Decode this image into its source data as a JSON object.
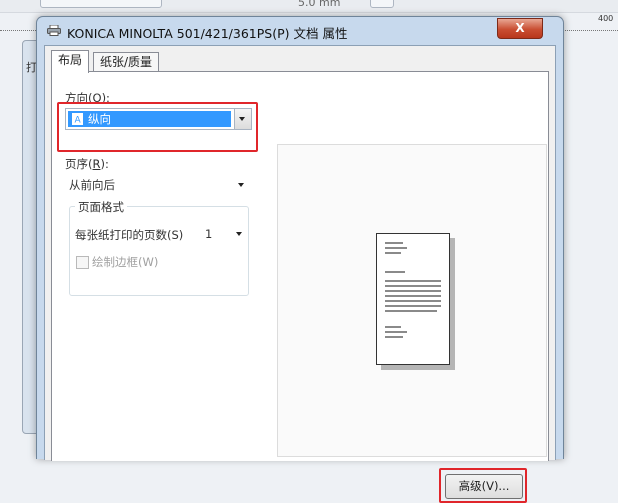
{
  "background": {
    "title_fragment": "5.0 mm",
    "ruler_number": "400",
    "panel_label": "打"
  },
  "dialog": {
    "title": "KONICA MINOLTA 501/421/361PS(P) 文档 属性",
    "close_label": "X",
    "tabs": [
      {
        "label": "布局",
        "active": true
      },
      {
        "label": "纸张/质量",
        "active": false
      }
    ],
    "orientation": {
      "label": "方向(O):",
      "label_text": "方向(",
      "label_key": "O",
      "label_end": "):",
      "value": "纵向"
    },
    "page_order": {
      "label_text": "页序(",
      "label_key": "R",
      "label_end": "):",
      "value": "从前向后"
    },
    "page_format": {
      "group_label": "页面格式",
      "pages_per_sheet_label": "每张纸打印的页数(S)",
      "pages_per_sheet_value": "1",
      "draw_borders_label": "绘制边框(W)",
      "draw_borders_checked": false
    },
    "advanced_button": "高级(V)...",
    "highlight_color": "#e0262b",
    "selection_color": "#3399ff"
  }
}
